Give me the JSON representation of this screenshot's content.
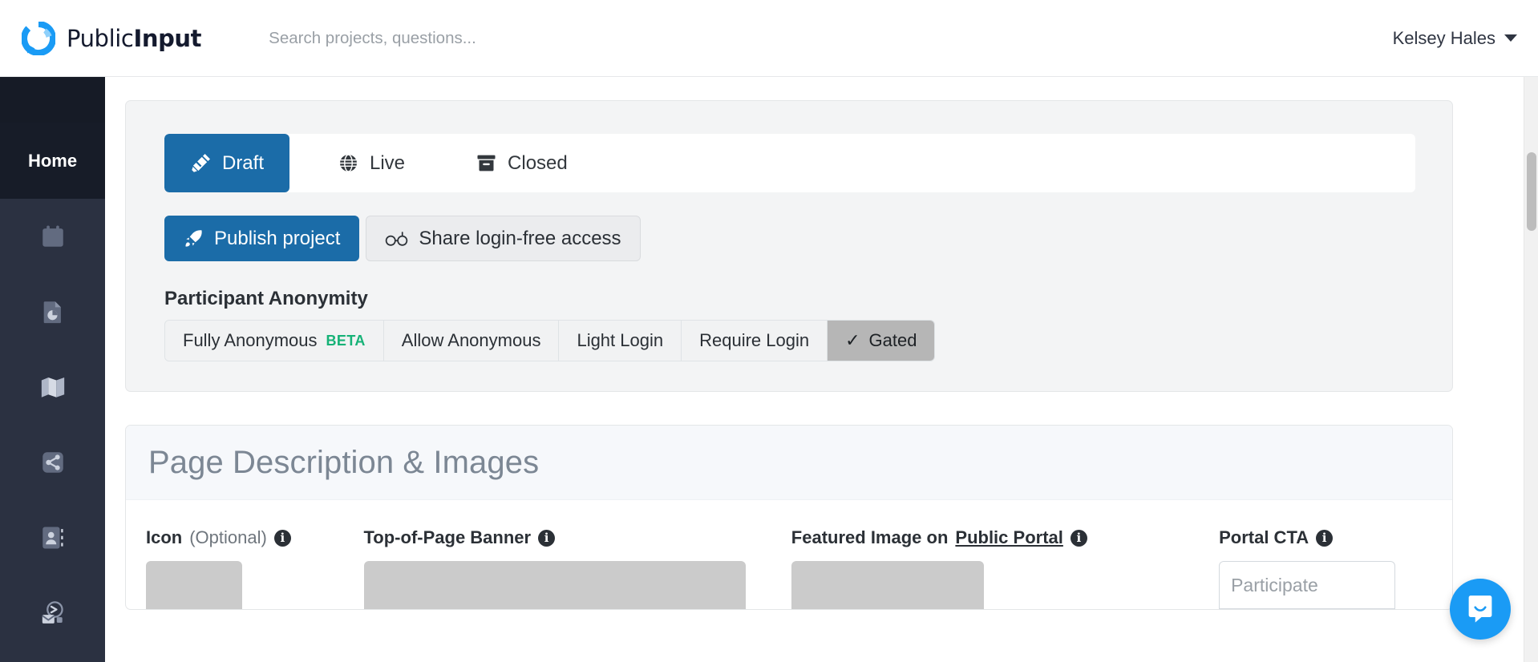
{
  "header": {
    "brand_light": "Public",
    "brand_bold": "Input",
    "brand_logo_color": "#1a9bf5",
    "search": {
      "value": "",
      "placeholder": "Search projects, questions..."
    },
    "user_name": "Kelsey Hales"
  },
  "sidebar": {
    "background": "#2b3141",
    "active_item_label": "Home",
    "items": [
      {
        "label": "Home",
        "icon": "home-label",
        "active": true
      },
      {
        "label": "Calendar",
        "icon": "calendar-icon",
        "active": false
      },
      {
        "label": "Reports",
        "icon": "report-document-icon",
        "active": false
      },
      {
        "label": "Map",
        "icon": "map-icon",
        "active": false
      },
      {
        "label": "Share",
        "icon": "share-nodes-icon",
        "active": false
      },
      {
        "label": "Contacts",
        "icon": "address-book-icon",
        "active": false
      },
      {
        "label": "Outreach",
        "icon": "mail-send-icon",
        "active": false
      }
    ]
  },
  "status_card": {
    "accent_color": "#1b6ca8",
    "tabs": [
      {
        "label": "Draft",
        "icon": "draft-pencil-icon",
        "active": true
      },
      {
        "label": "Live",
        "icon": "globe-icon",
        "active": false
      },
      {
        "label": "Closed",
        "icon": "archive-box-icon",
        "active": false
      }
    ],
    "buttons": [
      {
        "label": "Publish project",
        "icon": "rocket-icon",
        "style": "primary"
      },
      {
        "label": "Share login-free access",
        "icon": "glasses-icon",
        "style": "secondary"
      }
    ],
    "anonymity": {
      "title": "Participant Anonymity",
      "options": [
        {
          "label": "Fully Anonymous",
          "badge": "BETA",
          "badge_color": "#16b277",
          "selected": false
        },
        {
          "label": "Allow Anonymous",
          "badge": "",
          "selected": false
        },
        {
          "label": "Light Login",
          "badge": "",
          "selected": false
        },
        {
          "label": "Require Login",
          "badge": "",
          "selected": false
        },
        {
          "label": "Gated",
          "badge": "",
          "selected": true,
          "check": "✓"
        }
      ]
    }
  },
  "page_description_panel": {
    "title": "Page Description & Images",
    "fields": [
      {
        "label_main": "Icon",
        "label_optional": "(Optional)",
        "label_link": "",
        "info": "i"
      },
      {
        "label_main": "Top-of-Page Banner",
        "label_optional": "",
        "label_link": "",
        "info": "i"
      },
      {
        "label_main": "Featured Image on",
        "label_optional": "",
        "label_link": "Public Portal",
        "info": "i"
      },
      {
        "label_main": "Portal CTA",
        "label_optional": "",
        "label_link": "",
        "info": "i"
      }
    ],
    "cta_input": {
      "value": "",
      "placeholder": "Participate"
    }
  },
  "chat": {
    "icon": "intercom-chat-icon",
    "color": "#1a9bf5"
  }
}
